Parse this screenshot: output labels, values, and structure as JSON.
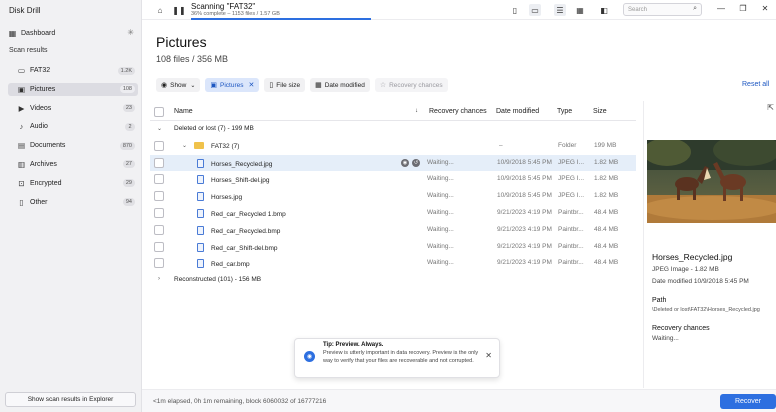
{
  "app": {
    "title": "Disk Drill"
  },
  "sidebar": {
    "dashboard_label": "Dashboard",
    "scan_results_header": "Scan results",
    "items": [
      {
        "label": "FAT32",
        "count": "1.2K",
        "icon": "drive-icon"
      },
      {
        "label": "Pictures",
        "count": "108",
        "icon": "picture-icon"
      },
      {
        "label": "Videos",
        "count": "23",
        "icon": "video-icon"
      },
      {
        "label": "Audio",
        "count": "2",
        "icon": "music-icon"
      },
      {
        "label": "Documents",
        "count": "870",
        "icon": "document-icon"
      },
      {
        "label": "Archives",
        "count": "27",
        "icon": "archive-icon"
      },
      {
        "label": "Encrypted",
        "count": "29",
        "icon": "lock-icon"
      },
      {
        "label": "Other",
        "count": "94",
        "icon": "other-file-icon"
      }
    ],
    "explorer_button": "Show scan results in Explorer"
  },
  "toolbar": {
    "scan_title": "Scanning \"FAT32\"",
    "scan_subtitle": "36% complete – 1153 files / 1.57 GB",
    "progress_percent": 36,
    "search_placeholder": "Search"
  },
  "header": {
    "title": "Pictures",
    "subtitle": "108 files / 356 MB"
  },
  "filters": {
    "show_label": "Show",
    "active_filter": "Pictures",
    "file_size": "File size",
    "date_modified": "Date modified",
    "recovery_chances": "Recovery chances",
    "reset_all": "Reset all"
  },
  "table": {
    "columns": {
      "name": "Name",
      "recovery": "Recovery chances",
      "date": "Date modified",
      "type": "Type",
      "size": "Size"
    },
    "group_deleted": "Deleted or lost (7) - 199 MB",
    "folder": {
      "name": "FAT32 (7)",
      "recovery": "–",
      "date": "",
      "type": "Folder",
      "size": "199 MB"
    },
    "rows": [
      {
        "name": "Horses_Recycled.jpg",
        "recovery": "Waiting...",
        "date": "10/9/2018 5:45 PM",
        "type": "JPEG I...",
        "size": "1.82 MB"
      },
      {
        "name": "Horses_Shift-del.jpg",
        "recovery": "Waiting...",
        "date": "10/9/2018 5:45 PM",
        "type": "JPEG I...",
        "size": "1.82 MB"
      },
      {
        "name": "Horses.jpg",
        "recovery": "Waiting...",
        "date": "10/9/2018 5:45 PM",
        "type": "JPEG I...",
        "size": "1.82 MB"
      },
      {
        "name": "Red_car_Recycled 1.bmp",
        "recovery": "Waiting...",
        "date": "9/21/2023 4:19 PM",
        "type": "Paintbr...",
        "size": "48.4 MB"
      },
      {
        "name": "Red_car_Recycled.bmp",
        "recovery": "Waiting...",
        "date": "9/21/2023 4:19 PM",
        "type": "Paintbr...",
        "size": "48.4 MB"
      },
      {
        "name": "Red_car_Shift-del.bmp",
        "recovery": "Waiting...",
        "date": "9/21/2023 4:19 PM",
        "type": "Paintbr...",
        "size": "48.4 MB"
      },
      {
        "name": "Red_car.bmp",
        "recovery": "Waiting...",
        "date": "9/21/2023 4:19 PM",
        "type": "Paintbr...",
        "size": "48.4 MB"
      }
    ],
    "group_reconstructed": "Reconstructed (101) - 156 MB"
  },
  "preview": {
    "file_name": "Horses_Recycled.jpg",
    "file_meta": "JPEG Image - 1.82 MB",
    "date_meta": "Date modified 10/9/2018 5:45 PM",
    "path_label": "Path",
    "path_value": "\\Deleted or lost\\FAT32\\Horses_Recycled.jpg",
    "recovery_label": "Recovery chances",
    "recovery_value": "Waiting..."
  },
  "tip": {
    "title": "Tip: Preview. Always.",
    "body": "Preview is utterly important in data recovery. Preview is the only way to verify that your files are recoverable and not corrupted."
  },
  "status": {
    "text": "<1m elapsed, 0h 1m remaining, block 6060032 of 16777216",
    "recover_button": "Recover"
  },
  "colors": {
    "accent": "#2d6fe0",
    "selection": "#e5eef9",
    "sidebar_bg": "#f1f1f3"
  }
}
